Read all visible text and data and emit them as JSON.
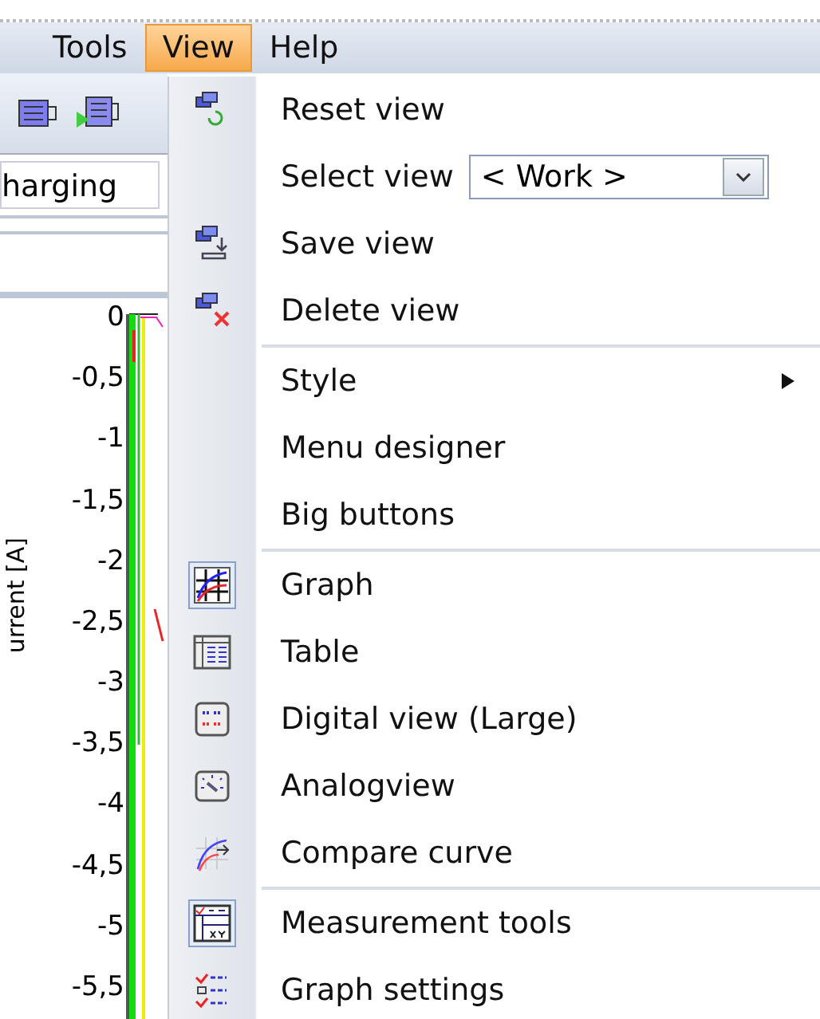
{
  "menubar": [
    {
      "label": "Tools",
      "selected": false
    },
    {
      "label": "View",
      "selected": true
    },
    {
      "label": "Help",
      "selected": false
    }
  ],
  "toolbar": {
    "field_value": "harging"
  },
  "chart": {
    "axis_label": "urrent [A]",
    "yticks": [
      "0",
      "-0,5",
      "-1",
      "-1,5",
      "-2",
      "-2,5",
      "-3",
      "-3,5",
      "-4",
      "-4,5",
      "-5",
      "-5,5"
    ]
  },
  "menu": {
    "items": [
      {
        "kind": "item",
        "label": "Reset view",
        "checked": false
      },
      {
        "kind": "combo",
        "label": "Select view",
        "value": "< Work >"
      },
      {
        "kind": "item",
        "label": "Save view",
        "checked": false
      },
      {
        "kind": "item",
        "label": "Delete view",
        "checked": false
      },
      {
        "kind": "separator"
      },
      {
        "kind": "submenu",
        "label": "Style"
      },
      {
        "kind": "item",
        "label": "Menu designer",
        "checked": false
      },
      {
        "kind": "item",
        "label": "Big buttons",
        "checked": false
      },
      {
        "kind": "separator"
      },
      {
        "kind": "item",
        "label": "Graph",
        "checked": true
      },
      {
        "kind": "item",
        "label": "Table",
        "checked": false
      },
      {
        "kind": "item",
        "label": "Digital view (Large)",
        "checked": false
      },
      {
        "kind": "item",
        "label": "Analogview",
        "checked": false
      },
      {
        "kind": "item",
        "label": "Compare curve",
        "checked": false
      },
      {
        "kind": "separator"
      },
      {
        "kind": "item",
        "label": "Measurement tools",
        "checked": true
      },
      {
        "kind": "item",
        "label": "Graph settings",
        "checked": false
      }
    ]
  }
}
